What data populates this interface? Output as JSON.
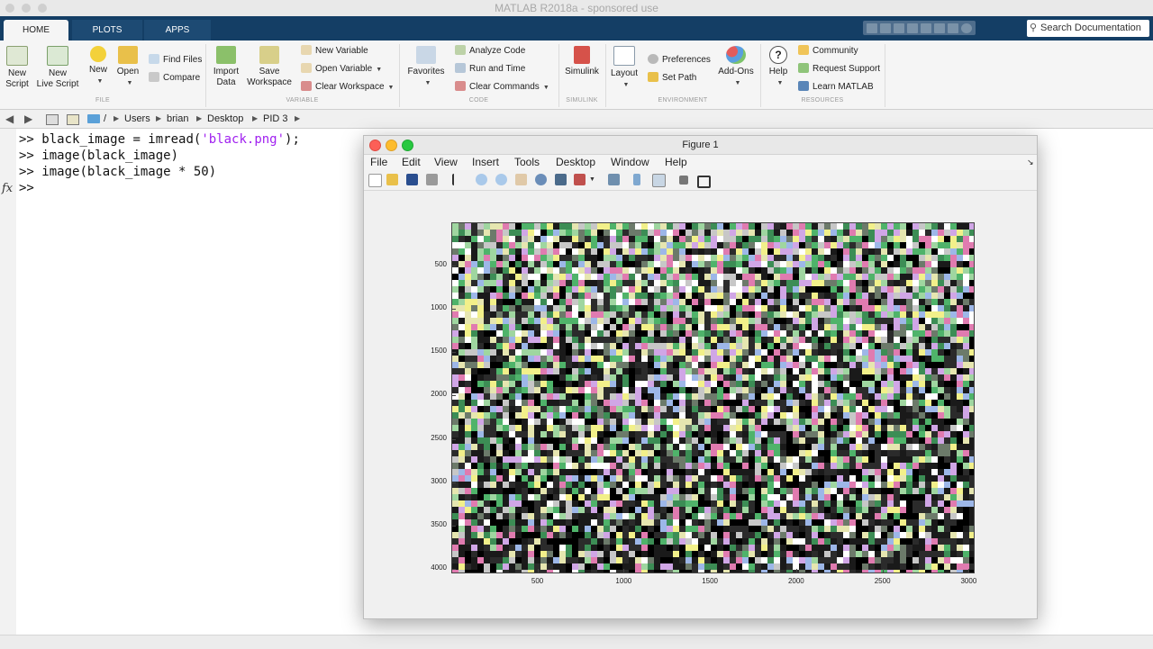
{
  "app": {
    "title": "MATLAB R2018a - sponsored use"
  },
  "tabs": [
    {
      "label": "HOME"
    },
    {
      "label": "PLOTS"
    },
    {
      "label": "APPS"
    }
  ],
  "search": {
    "placeholder": "Search Documentation"
  },
  "ribbon": {
    "file": {
      "new_script": "New\nScript",
      "new_live_script": "New\nLive Script",
      "new": "New",
      "open": "Open",
      "find_files": "Find Files",
      "compare": "Compare",
      "section": "FILE"
    },
    "variable": {
      "import_data": "Import\nData",
      "save_workspace": "Save\nWorkspace",
      "new_variable": "New Variable",
      "open_variable": "Open Variable",
      "clear_workspace": "Clear Workspace",
      "section": "VARIABLE"
    },
    "code": {
      "favorites": "Favorites",
      "analyze_code": "Analyze Code",
      "run_and_time": "Run and Time",
      "clear_commands": "Clear Commands",
      "section": "CODE"
    },
    "simulink": {
      "simulink": "Simulink",
      "section": "SIMULINK"
    },
    "environment": {
      "layout": "Layout",
      "preferences": "Preferences",
      "set_path": "Set Path",
      "add_ons": "Add-Ons",
      "section": "ENVIRONMENT"
    },
    "resources": {
      "help": "Help",
      "community": "Community",
      "request_support": "Request Support",
      "learn_matlab": "Learn MATLAB",
      "section": "RESOURCES"
    }
  },
  "address": {
    "root": "/",
    "crumbs": [
      "Users",
      "brian",
      "Desktop",
      "PID 3"
    ]
  },
  "command_window": {
    "prompt": ">>",
    "lines": [
      {
        "before": "black_image = imread(",
        "string": "'black.png'",
        "after": ");"
      },
      {
        "before": "image(black_image)",
        "string": "",
        "after": ""
      },
      {
        "before": "image(black_image * 50)",
        "string": "",
        "after": ""
      }
    ],
    "fx": "fx"
  },
  "figure": {
    "title": "Figure 1",
    "menu": [
      "File",
      "Edit",
      "View",
      "Insert",
      "Tools",
      "Desktop",
      "Window",
      "Help"
    ]
  },
  "chart_data": {
    "type": "heatmap",
    "title": "",
    "xlabel": "",
    "ylabel": "",
    "x_ticks": [
      500,
      1000,
      1500,
      2000,
      2500,
      3000
    ],
    "y_ticks": [
      500,
      1000,
      1500,
      2000,
      2500,
      3000,
      3500,
      4000
    ],
    "xlim": [
      1,
      3024
    ],
    "ylim": [
      1,
      4032
    ],
    "y_reversed": true,
    "grid": false,
    "content": "noise image"
  }
}
